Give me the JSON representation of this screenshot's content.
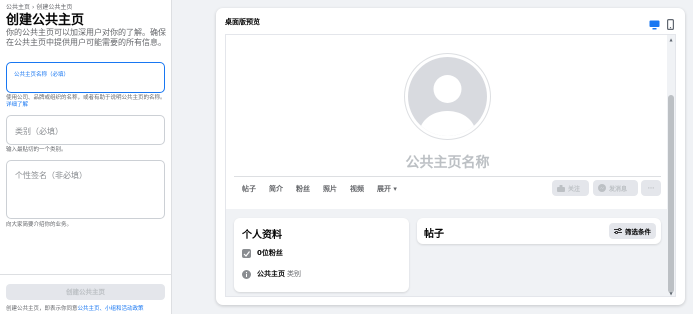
{
  "breadcrumb": {
    "parent": "公共主页",
    "sep": "›",
    "current": "创建公共主页"
  },
  "form": {
    "title": "创建公共主页",
    "description": "你的公共主页可以加深用户对你的了解。确保在公共主页中提供用户可能需要的所有信息。",
    "name_field": {
      "label": "公共主页名称（必填）"
    },
    "name_help": "使用公司、品牌或组织的名称，或者有助于说明公共主页的名称。",
    "name_help_link": "详细了解",
    "category_field": {
      "placeholder": "类别（必填）"
    },
    "category_help": "输入最贴切的一个类别。",
    "bio_field": {
      "placeholder": "个性签名（非必填）"
    },
    "bio_help": "向大家简要介绍你的业务。",
    "create_button": "创建公共主页",
    "footer_text": "创建公共主页，即表示你同意",
    "footer_link": "公共主页、小组和活动政策"
  },
  "preview": {
    "title": "桌面版预览",
    "devices": [
      {
        "name": "desktop",
        "active": true
      },
      {
        "name": "mobile",
        "active": false
      }
    ],
    "page_name": "公共主页名称",
    "tabs": [
      "帖子",
      "简介",
      "粉丝",
      "照片",
      "视频",
      "展开"
    ],
    "actions": {
      "follow": "关注",
      "message": "发消息",
      "more": "···"
    },
    "intro": {
      "title": "个人资料",
      "followers": "0位粉丝",
      "page_label": "公共主页",
      "page_category": "类别"
    },
    "posts": {
      "title": "帖子",
      "filter": "筛选条件"
    }
  },
  "colors": {
    "accent": "#1877f2",
    "disabled": "#bcc0c4",
    "background": "#f0f2f5"
  }
}
